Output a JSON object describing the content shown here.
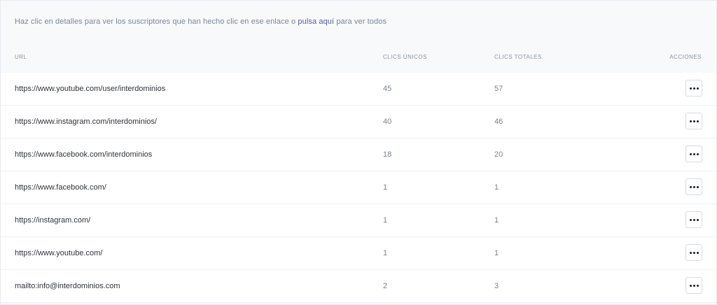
{
  "info": {
    "text_before": "Haz clic en detalles para ver los suscriptores que han hecho clic en ese enlace o ",
    "link_text": "pulsa aquí",
    "text_after": " para ver todos"
  },
  "table": {
    "headers": {
      "url": "URL",
      "unique_clicks": "CLICS ÚNICOS",
      "total_clicks": "CLICS TOTALES",
      "actions": "ACCIONES"
    },
    "rows": [
      {
        "url": "https://www.youtube.com/user/interdominios",
        "unique": "45",
        "total": "57"
      },
      {
        "url": "https://www.instagram.com/interdominios/",
        "unique": "40",
        "total": "46"
      },
      {
        "url": "https://www.facebook.com/interdominios",
        "unique": "18",
        "total": "20"
      },
      {
        "url": "https://www.facebook.com/",
        "unique": "1",
        "total": "1"
      },
      {
        "url": "https://instagram.com/",
        "unique": "1",
        "total": "1"
      },
      {
        "url": "https://www.youtube.com/",
        "unique": "1",
        "total": "1"
      },
      {
        "url": "mailto:info@interdominios.com",
        "unique": "2",
        "total": "3"
      }
    ],
    "action_icon": "more-horizontal-icon"
  },
  "colors": {
    "link": "#5b5e9c",
    "background": "#f7f9fb",
    "row": "#ffffff"
  }
}
